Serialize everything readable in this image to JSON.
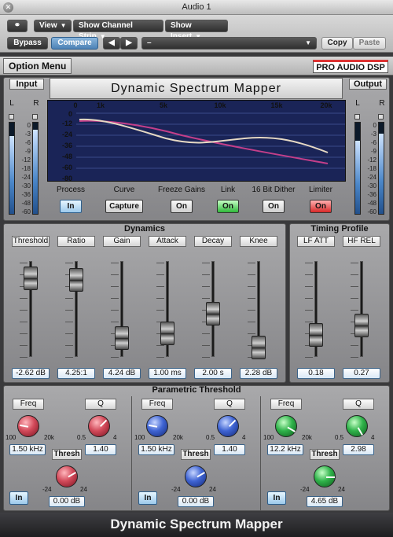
{
  "window": {
    "title": "Audio 1"
  },
  "toolbar": {
    "view": "View",
    "show_channel_strip": "Show Channel Strip",
    "show_insert": "Show Insert",
    "bypass": "Bypass",
    "compare": "Compare",
    "prev": "◀",
    "next": "▶",
    "preset": "–",
    "copy": "Copy",
    "paste": "Paste"
  },
  "plugin": {
    "option_menu": "Option Menu",
    "brand": "PRO AUDIO DSP",
    "title": "Dynamic Spectrum Mapper",
    "footer_title": "Dynamic Spectrum Mapper"
  },
  "meters": {
    "input_label": "Input",
    "output_label": "Output",
    "left": "L",
    "right": "R",
    "scale": [
      "0",
      "-3",
      "-6",
      "-9",
      "-12",
      "-18",
      "-24",
      "-30",
      "-36",
      "-48",
      "-60"
    ],
    "input_levels": [
      0.85,
      0.92
    ],
    "output_levels": [
      0.8,
      0.88
    ]
  },
  "graph": {
    "freq_labels": [
      "0",
      "1k",
      "5k",
      "10k",
      "15k",
      "20k"
    ],
    "db_labels": [
      "0",
      "-12",
      "-24",
      "-36",
      "-48",
      "-60",
      "-80"
    ]
  },
  "controls": [
    {
      "label": "Process",
      "value": "In"
    },
    {
      "label": "Curve",
      "value": "Capture"
    },
    {
      "label": "Freeze Gains",
      "value": "On"
    },
    {
      "label": "Link",
      "value": "On"
    },
    {
      "label": "16 Bit Dither",
      "value": "On"
    },
    {
      "label": "Limiter",
      "value": "On"
    }
  ],
  "dynamics": {
    "title": "Dynamics",
    "faders": [
      {
        "label": "Threshold",
        "value": "-2.62 dB",
        "level": 0.82
      },
      {
        "label": "Ratio",
        "value": "4.25:1",
        "level": 0.8
      },
      {
        "label": "Gain",
        "value": "4.24 dB",
        "level": 0.2
      },
      {
        "label": "Attack",
        "value": "1.00 ms",
        "level": 0.25
      },
      {
        "label": "Decay",
        "value": "2.00 s",
        "level": 0.45
      },
      {
        "label": "Knee",
        "value": "2.28 dB",
        "level": 0.1
      }
    ]
  },
  "timing": {
    "title": "Timing Profile",
    "faders": [
      {
        "label": "LF ATT",
        "value": "0.18",
        "level": 0.23
      },
      {
        "label": "HF REL",
        "value": "0.27",
        "level": 0.33
      }
    ]
  },
  "parametric": {
    "title": "Parametric Threshold",
    "bands": [
      {
        "freq_label": "Freq",
        "freq_value": "1.50 kHz",
        "freq_min": "100",
        "freq_max": "20k",
        "q_label": "Q",
        "q_value": "1.40",
        "q_min": "0.5",
        "q_max": "4",
        "thresh_label": "Thresh",
        "thresh_value": "0.00 dB",
        "thresh_min": "-24",
        "thresh_max": "24",
        "in_label": "In",
        "color": "#d24a5a"
      },
      {
        "freq_label": "Freq",
        "freq_value": "1.50 kHz",
        "freq_min": "100",
        "freq_max": "20k",
        "q_label": "Q",
        "q_value": "1.40",
        "q_min": "0.5",
        "q_max": "4",
        "thresh_label": "Thresh",
        "thresh_value": "0.00 dB",
        "thresh_min": "-24",
        "thresh_max": "24",
        "in_label": "In",
        "color": "#3f64d3"
      },
      {
        "freq_label": "Freq",
        "freq_value": "12.2 kHz",
        "freq_min": "100",
        "freq_max": "20k",
        "q_label": "Q",
        "q_value": "2.98",
        "q_min": "0.5",
        "q_max": "4",
        "thresh_label": "Thresh",
        "thresh_value": "4.65 dB",
        "thresh_min": "-24",
        "thresh_max": "24",
        "in_label": "In",
        "color": "#2fb34a"
      }
    ]
  }
}
